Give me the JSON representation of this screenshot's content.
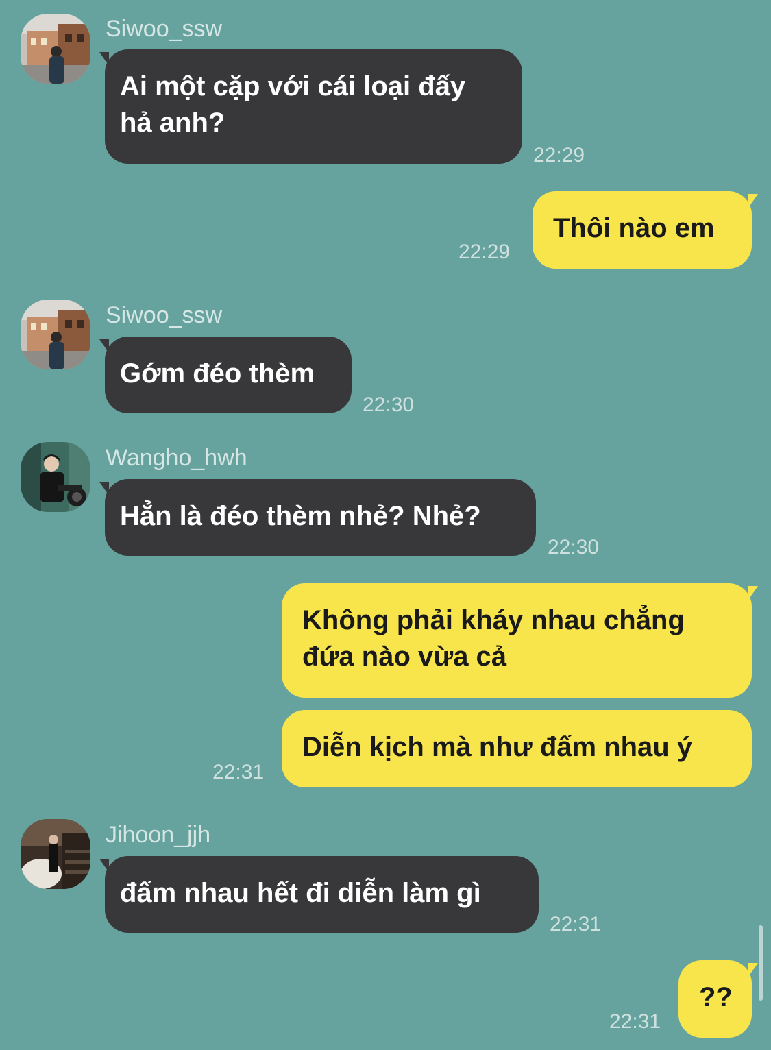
{
  "colors": {
    "background": "#66a39f",
    "incoming_bubble": "#38383b",
    "outgoing_bubble": "#f8e54b"
  },
  "messages": [
    {
      "sender": "Siwoo_ssw",
      "text": "Ai một cặp với cái loại đấy\nhả anh?",
      "time": "22:29",
      "direction": "incoming"
    },
    {
      "text": "Thôi nào em",
      "time": "22:29",
      "direction": "outgoing"
    },
    {
      "sender": "Siwoo_ssw",
      "text": "Gớm đéo thèm",
      "time": "22:30",
      "direction": "incoming"
    },
    {
      "sender": "Wangho_hwh",
      "text": "Hẳn là đéo thèm nhẻ? Nhẻ?",
      "time": "22:30",
      "direction": "incoming"
    },
    {
      "text": "Không phải kháy nhau chẳng\nđứa nào vừa cả",
      "direction": "outgoing"
    },
    {
      "text": "Diễn kịch mà như đấm nhau ý",
      "time": "22:31",
      "direction": "outgoing"
    },
    {
      "sender": "Jihoon_jjh",
      "text": "đấm nhau hết đi diễn làm gì",
      "time": "22:31",
      "direction": "incoming"
    },
    {
      "text": "??",
      "time": "22:31",
      "direction": "outgoing"
    }
  ]
}
